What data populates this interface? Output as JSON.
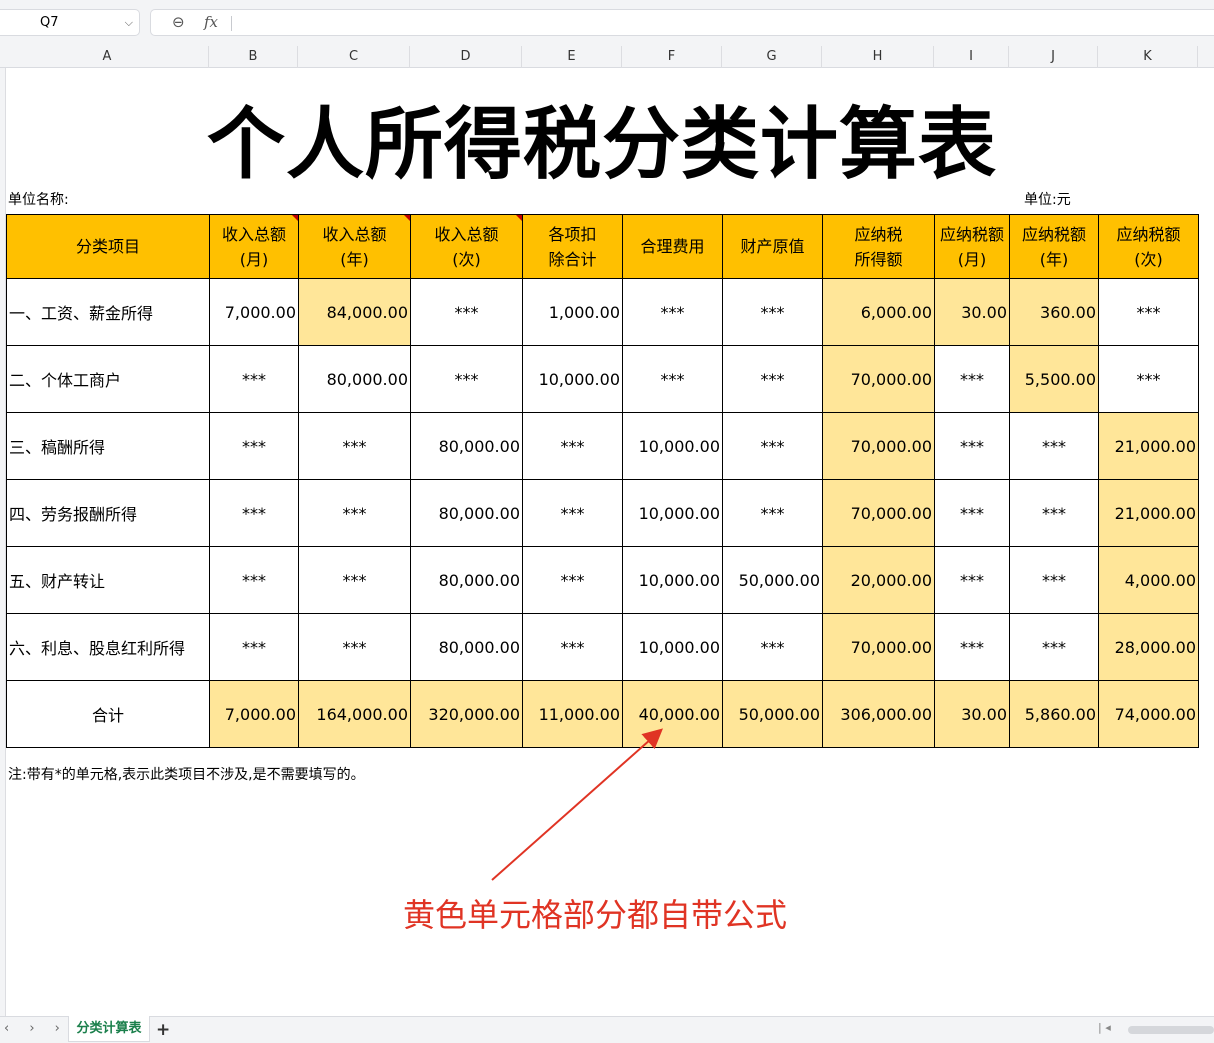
{
  "toolbar": {
    "cell_ref": "Q7",
    "chevron_icon": "chevron-down-icon",
    "zoom_icon": "zoom-out-icon",
    "fx_label": "fx",
    "formula": ""
  },
  "columns": [
    "A",
    "B",
    "C",
    "D",
    "E",
    "F",
    "G",
    "H",
    "I",
    "J",
    "K"
  ],
  "sheet": {
    "title": "个人所得税分类计算表",
    "unit_name_label": "单位名称:",
    "unit_label": "单位:元",
    "headers": [
      {
        "text": "分类项目",
        "comment": false
      },
      {
        "text": "收入总额\n(月)",
        "comment": true
      },
      {
        "text": "收入总额\n(年)",
        "comment": true
      },
      {
        "text": "收入总额\n(次)",
        "comment": true
      },
      {
        "text": "各项扣\n除合计",
        "comment": false
      },
      {
        "text": "合理费用",
        "comment": false
      },
      {
        "text": "财产原值",
        "comment": false
      },
      {
        "text": "应纳税\n所得额",
        "comment": false
      },
      {
        "text": "应纳税额\n(月)",
        "comment": false
      },
      {
        "text": "应纳税额\n(年)",
        "comment": false
      },
      {
        "text": "应纳税额\n(次)",
        "comment": false
      }
    ],
    "rows": [
      {
        "cells": [
          "一、工资、薪金所得",
          "7,000.00",
          "84,000.00",
          "***",
          "1,000.00",
          "***",
          "***",
          "6,000.00",
          "30.00",
          "360.00",
          "***"
        ],
        "yellow": [
          false,
          false,
          true,
          false,
          false,
          false,
          false,
          true,
          true,
          true,
          false
        ]
      },
      {
        "cells": [
          "二、个体工商户",
          "***",
          "80,000.00",
          "***",
          "10,000.00",
          "***",
          "***",
          "70,000.00",
          "***",
          "5,500.00",
          "***"
        ],
        "yellow": [
          false,
          false,
          false,
          false,
          false,
          false,
          false,
          true,
          false,
          true,
          false
        ]
      },
      {
        "cells": [
          "三、稿酬所得",
          "***",
          "***",
          "80,000.00",
          "***",
          "10,000.00",
          "***",
          "70,000.00",
          "***",
          "***",
          "21,000.00"
        ],
        "yellow": [
          false,
          false,
          false,
          false,
          false,
          false,
          false,
          true,
          false,
          false,
          true
        ]
      },
      {
        "cells": [
          "四、劳务报酬所得",
          "***",
          "***",
          "80,000.00",
          "***",
          "10,000.00",
          "***",
          "70,000.00",
          "***",
          "***",
          "21,000.00"
        ],
        "yellow": [
          false,
          false,
          false,
          false,
          false,
          false,
          false,
          true,
          false,
          false,
          true
        ]
      },
      {
        "cells": [
          "五、财产转让",
          "***",
          "***",
          "80,000.00",
          "***",
          "10,000.00",
          "50,000.00",
          "20,000.00",
          "***",
          "***",
          "4,000.00"
        ],
        "yellow": [
          false,
          false,
          false,
          false,
          false,
          false,
          false,
          true,
          false,
          false,
          true
        ]
      },
      {
        "cells": [
          "六、利息、股息红利所得",
          "***",
          "***",
          "80,000.00",
          "***",
          "10,000.00",
          "***",
          "70,000.00",
          "***",
          "***",
          "28,000.00"
        ],
        "yellow": [
          false,
          false,
          false,
          false,
          false,
          false,
          false,
          true,
          false,
          false,
          true
        ]
      },
      {
        "cells": [
          "合计",
          "7,000.00",
          "164,000.00",
          "320,000.00",
          "11,000.00",
          "40,000.00",
          "50,000.00",
          "306,000.00",
          "30.00",
          "5,860.00",
          "74,000.00"
        ],
        "yellow": [
          false,
          true,
          true,
          true,
          true,
          true,
          true,
          true,
          true,
          true,
          true
        ]
      }
    ],
    "note": "注:带有*的单元格,表示此类项目不涉及,是不需要填写的。",
    "annotation": "黄色单元格部分都自带公式"
  },
  "bottom": {
    "nav_symbols": "‹ › ›|",
    "sheet_tab": "分类计算表",
    "add_sheet": "+"
  },
  "colors": {
    "header_fill": "#ffc000",
    "formula_fill": "#ffe699",
    "annotation": "#e03424",
    "tab_text": "#1a7f4b"
  }
}
